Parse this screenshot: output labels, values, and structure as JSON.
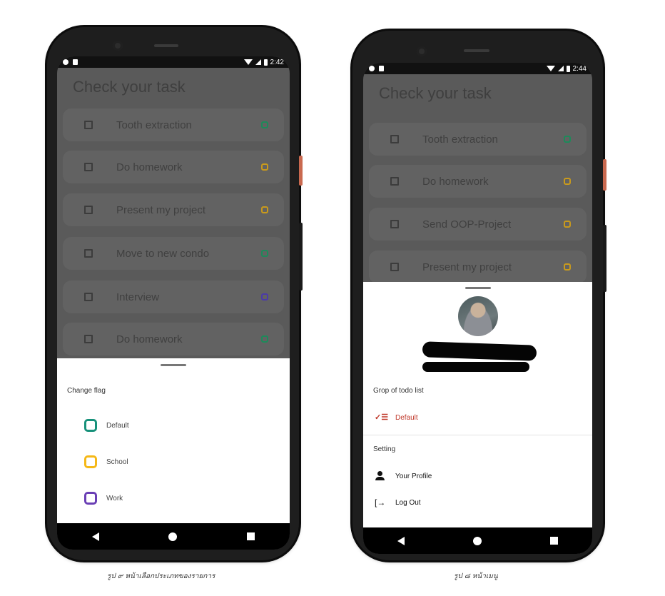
{
  "left_phone": {
    "status": {
      "time": "2:42"
    },
    "app_title": "Check your task",
    "tasks": [
      {
        "label": "Tooth extraction",
        "flag_color": "#1d8a5a"
      },
      {
        "label": "Do homework",
        "flag_color": "#c99a1c"
      },
      {
        "label": "Present my project",
        "flag_color": "#c99a1c"
      },
      {
        "label": "Move to new condo",
        "flag_color": "#1d8a5a"
      },
      {
        "label": "Interview",
        "flag_color": "#4b3aa8"
      },
      {
        "label": "Do homework",
        "flag_color": "#1d8a5a"
      }
    ],
    "sheet": {
      "heading": "Change flag",
      "flags": [
        {
          "label": "Default",
          "color": "#17917a",
          "icon": "teal-flag-icon"
        },
        {
          "label": "School",
          "color": "#f5b817",
          "icon": "yellow-flag-icon"
        },
        {
          "label": "Work",
          "color": "#6a3fb5",
          "icon": "purple-flag-icon"
        }
      ]
    },
    "caption": "รูป ๙ หน้าเลือกประเภทของรายการ"
  },
  "right_phone": {
    "status": {
      "time": "2:44"
    },
    "app_title": "Check your task",
    "tasks": [
      {
        "label": "Tooth extraction",
        "flag_color": "#1d8a5a"
      },
      {
        "label": "Do homework",
        "flag_color": "#c99a1c"
      },
      {
        "label": "Send OOP-Project",
        "flag_color": "#c99a1c"
      },
      {
        "label": "Present my project",
        "flag_color": "#c99a1c"
      }
    ],
    "menu": {
      "group_heading": "Grop of todo list",
      "group_item": "Default",
      "setting_heading": "Setting",
      "profile_label": "Your Profile",
      "logout_label": "Log Out"
    },
    "caption": "รูป ๘ หน้าเมนู"
  },
  "colors": {
    "accent_red": "#c0392b",
    "dim_overlay": "#5a5a5a"
  }
}
